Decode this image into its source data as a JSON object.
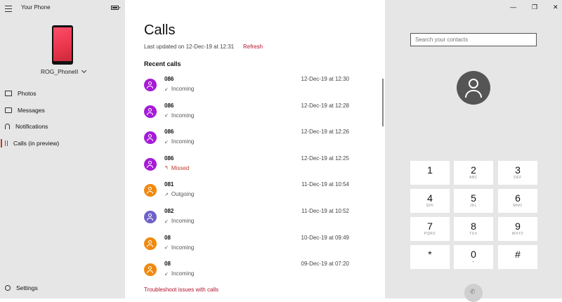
{
  "app": {
    "title": "Your Phone",
    "device_name": "ROG_PhoneII"
  },
  "sidebar": {
    "items": [
      {
        "label": "Photos",
        "icon": "photo-icon"
      },
      {
        "label": "Messages",
        "icon": "message-icon"
      },
      {
        "label": "Notifications",
        "icon": "bell-icon"
      },
      {
        "label": "Calls (in preview)",
        "icon": "calls-icon"
      }
    ],
    "settings_label": "Settings"
  },
  "calls": {
    "title": "Calls",
    "last_updated": "Last updated on 12-Dec-19 at 12:31",
    "refresh_label": "Refresh",
    "recent_label": "Recent calls",
    "troubleshoot_label": "Troubleshoot issues with calls",
    "list": [
      {
        "number": "086",
        "type": "Incoming",
        "time": "12-Dec-19 at 12:30",
        "color": "#a61bd8"
      },
      {
        "number": "086",
        "type": "Incoming",
        "time": "12-Dec-19 at 12:28",
        "color": "#a61bd8"
      },
      {
        "number": "086",
        "type": "Incoming",
        "time": "12-Dec-19 at 12:26",
        "color": "#a61bd8"
      },
      {
        "number": "086",
        "type": "Missed",
        "time": "12-Dec-19 at 12:25",
        "color": "#a61bd8"
      },
      {
        "number": "081",
        "type": "Outgoing",
        "time": "11-Dec-19 at 10:54",
        "color": "#f0890f"
      },
      {
        "number": "082",
        "type": "Incoming",
        "time": "11-Dec-19 at 10:52",
        "color": "#6e62c8"
      },
      {
        "number": "08",
        "type": "Incoming",
        "time": "10-Dec-19 at 09:49",
        "color": "#f0890f"
      },
      {
        "number": "08",
        "type": "Incoming",
        "time": "09-Dec-19 at 07:20",
        "color": "#f0890f"
      }
    ]
  },
  "dialer": {
    "search_placeholder": "Search your contacts",
    "keys": [
      {
        "digit": "1",
        "letters": ""
      },
      {
        "digit": "2",
        "letters": "ABC"
      },
      {
        "digit": "3",
        "letters": "DEF"
      },
      {
        "digit": "4",
        "letters": "GHI"
      },
      {
        "digit": "5",
        "letters": "JKL"
      },
      {
        "digit": "6",
        "letters": "MNO"
      },
      {
        "digit": "7",
        "letters": "PQRS"
      },
      {
        "digit": "8",
        "letters": "TUV"
      },
      {
        "digit": "9",
        "letters": "WXYZ"
      },
      {
        "digit": "*",
        "letters": ""
      },
      {
        "digit": "0",
        "letters": "+"
      },
      {
        "digit": "#",
        "letters": ""
      }
    ]
  },
  "colors": {
    "accent": "#b0122a",
    "missed": "#c0392b",
    "sidebar_bg": "#e6e6e6"
  }
}
